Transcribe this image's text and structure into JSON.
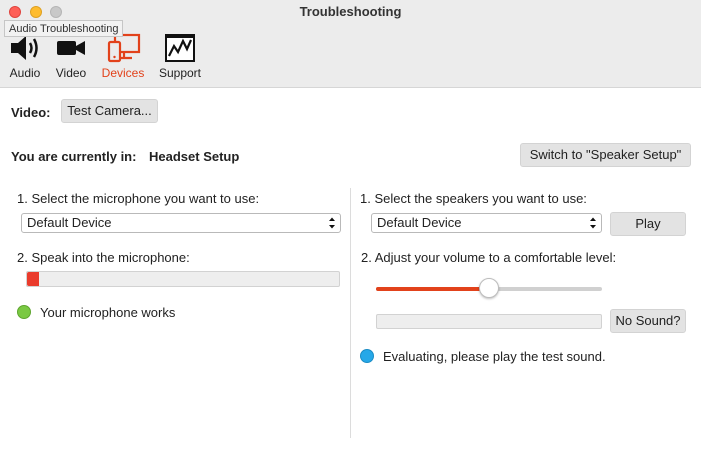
{
  "window": {
    "title": "Troubleshooting",
    "tooltip": "Audio Troubleshooting"
  },
  "toolbar": {
    "items": [
      {
        "label": "Audio",
        "icon": "speaker-icon",
        "active": false
      },
      {
        "label": "Video",
        "icon": "video-camera-icon",
        "active": false
      },
      {
        "label": "Devices",
        "icon": "devices-icon",
        "active": true
      },
      {
        "label": "Support",
        "icon": "support-chart-icon",
        "active": false
      }
    ]
  },
  "video": {
    "label": "Video:",
    "test_camera_label": "Test Camera..."
  },
  "setup": {
    "prefix": "You are currently in:",
    "current": "Headset Setup",
    "switch_label": "Switch to \"Speaker Setup\""
  },
  "microphone": {
    "step1": "1. Select the microphone you want to use:",
    "selected": "Default Device",
    "step2": "2. Speak into the microphone:",
    "level": 0.04,
    "status": "Your microphone works"
  },
  "speakers": {
    "step1": "1. Select the speakers you want to use:",
    "selected": "Default Device",
    "play_label": "Play",
    "step2": "2. Adjust your volume to a comfortable level:",
    "volume": 0.5,
    "no_sound_label": "No Sound?",
    "status": "Evaluating, please play the test sound."
  },
  "colors": {
    "accent": "#e2421b",
    "status_ok": "#7ac943",
    "status_info": "#26a8e8"
  }
}
